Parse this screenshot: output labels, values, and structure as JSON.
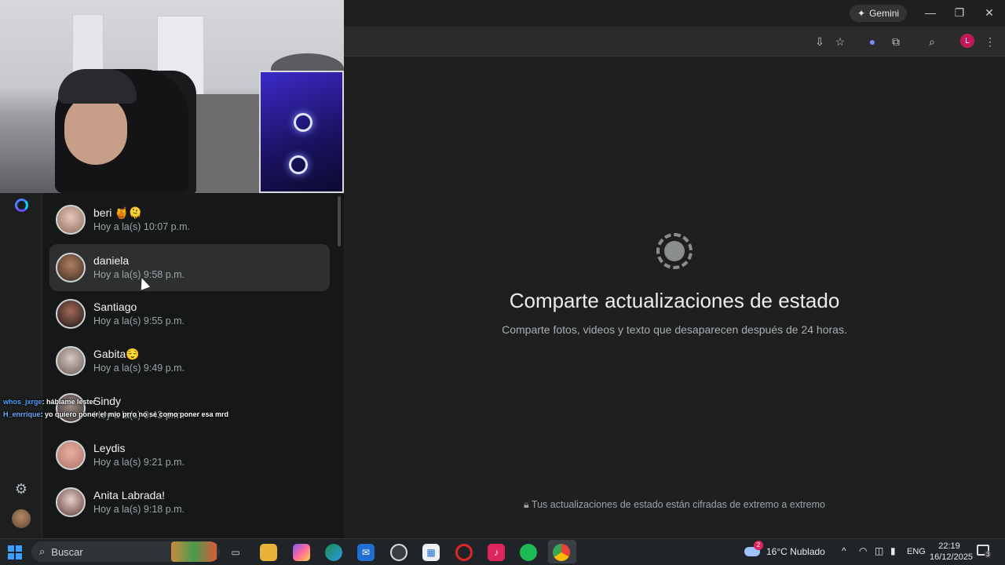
{
  "browser": {
    "gemini_label": "Gemini"
  },
  "chats": [
    {
      "name": "beri 🍯🫠",
      "time": "Hoy a la(s) 10:07 p.m."
    },
    {
      "name": "daniela",
      "time": "Hoy a la(s) 9:58 p.m."
    },
    {
      "name": "Santiago",
      "time": "Hoy a la(s) 9:55 p.m."
    },
    {
      "name": "Gabita😌",
      "time": "Hoy a la(s) 9:49 p.m."
    },
    {
      "name": "Sindy",
      "time": "Hoy a la(s) 9:43 p.m."
    },
    {
      "name": "Leydis",
      "time": "Hoy a la(s) 9:21 p.m."
    },
    {
      "name": "Anita Labrada!",
      "time": "Hoy a la(s) 9:18 p.m."
    }
  ],
  "stream_chat": [
    {
      "user": "whos_jxrge",
      "message": ": háblame lester"
    },
    {
      "user": "H_enrrique",
      "message": ": yo quiero poner el mio prro no se como poner esa mrd"
    }
  ],
  "main": {
    "title": "Comparte actualizaciones de estado",
    "subtitle": "Comparte fotos, videos y texto que desaparecen después de 24 horas.",
    "encryption_note": "Tus actualizaciones de estado están cifradas de extremo a extremo"
  },
  "profile_initial": "L",
  "taskbar": {
    "search_label": "Buscar",
    "weather": "16°C  Nublado",
    "weather_badge": "2",
    "language": "ENG",
    "time": "22:19",
    "date": "16/12/2025",
    "notifications": "3"
  },
  "colors": {
    "accent_ring": "#4a7cff",
    "panel_bg": "#161717",
    "main_bg": "#1f1f1f",
    "active_row": "#2e2f2f"
  }
}
